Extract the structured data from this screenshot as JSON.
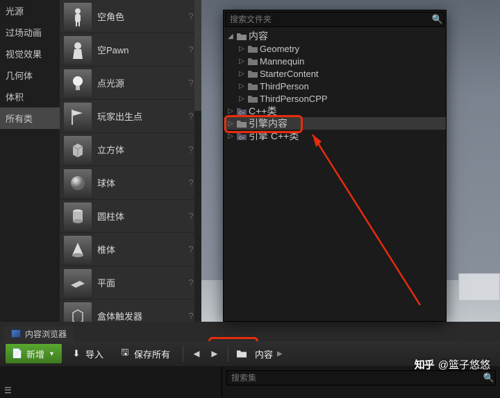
{
  "categories": [
    {
      "label": "光源",
      "selected": false
    },
    {
      "label": "过场动画",
      "selected": false
    },
    {
      "label": "视觉效果",
      "selected": false
    },
    {
      "label": "几何体",
      "selected": false
    },
    {
      "label": "体积",
      "selected": false
    },
    {
      "label": "所有类",
      "selected": true
    }
  ],
  "actors": [
    {
      "label": "空角色",
      "icon": "character"
    },
    {
      "label": "空Pawn",
      "icon": "pawn"
    },
    {
      "label": "点光源",
      "icon": "light"
    },
    {
      "label": "玩家出生点",
      "icon": "playerstart"
    },
    {
      "label": "立方体",
      "icon": "cube"
    },
    {
      "label": "球体",
      "icon": "sphere"
    },
    {
      "label": "圆柱体",
      "icon": "cylinder"
    },
    {
      "label": "椎体",
      "icon": "cone"
    },
    {
      "label": "平面",
      "icon": "plane"
    },
    {
      "label": "盒体触发器",
      "icon": "trigger"
    }
  ],
  "tree": {
    "search_placeholder": "搜索文件夹",
    "root_label": "内容",
    "children": [
      {
        "label": "Geometry"
      },
      {
        "label": "Mannequin"
      },
      {
        "label": "StarterContent"
      },
      {
        "label": "ThirdPerson"
      },
      {
        "label": "ThirdPersonCPP"
      }
    ],
    "siblings": [
      {
        "label": "C++类",
        "special": "cpp"
      },
      {
        "label": "引擎内容",
        "highlighted": true,
        "selected": true
      },
      {
        "label": "引擎 C++类",
        "special": "cpp"
      }
    ]
  },
  "content_browser": {
    "tab_label": "内容浏览器",
    "add_new": "新增",
    "import": "导入",
    "save_all": "保存所有",
    "breadcrumb_root": "内容",
    "search_sets_placeholder": "搜索集"
  },
  "watermark": {
    "logo": "知乎",
    "user": "@篮子悠悠"
  }
}
